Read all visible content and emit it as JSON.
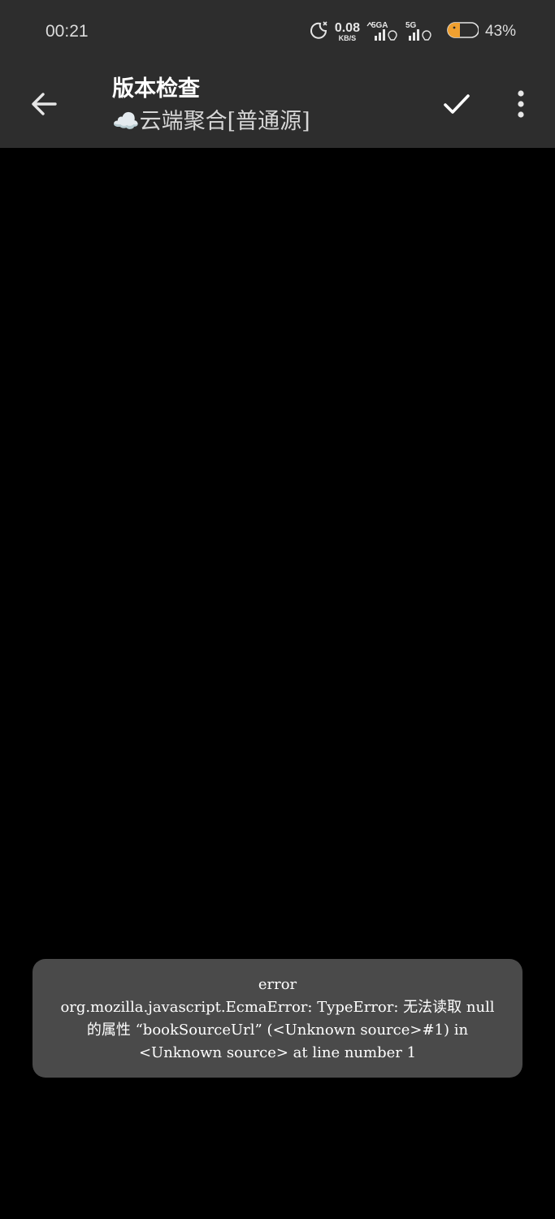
{
  "status_bar": {
    "time": "00:21",
    "speed_value": "0.08",
    "speed_unit": "KB/S",
    "sim1_label": "5GA",
    "sim2_label": "5G",
    "battery_percent": "43%"
  },
  "app_bar": {
    "title": "版本检查",
    "subtitle": "☁️云端聚合[普通源]"
  },
  "toast": {
    "line1": "error",
    "message": "org.mozilla.javascript.EcmaError: TypeError: 无法读取 null 的属性 “bookSourceUrl” (<Unknown source>#1) in <Unknown source> at line number 1"
  },
  "colors": {
    "bar_bg": "#2d2d2d",
    "content_bg": "#000000",
    "toast_bg": "#4a4a4a",
    "battery_fill": "#f0a030"
  }
}
